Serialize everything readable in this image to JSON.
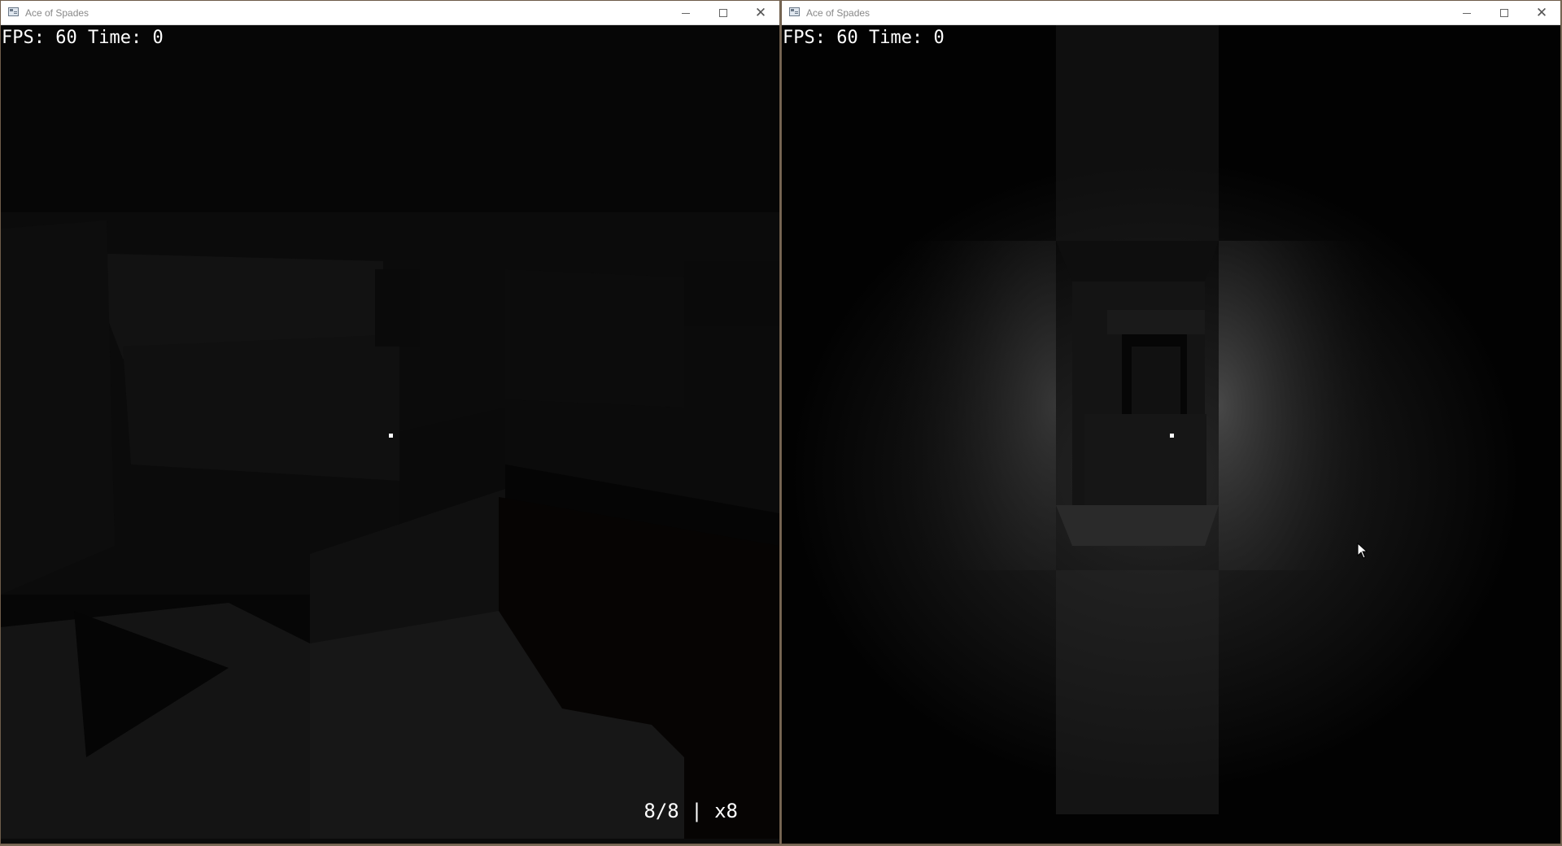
{
  "windows": [
    {
      "title": "Ace of Spades",
      "hud": {
        "fps_label": "FPS:",
        "fps_value": "60",
        "time_label": "Time:",
        "time_value": "0",
        "ammo": "8/8 | x8"
      }
    },
    {
      "title": "Ace of Spades",
      "hud": {
        "fps_label": "FPS:",
        "fps_value": "60",
        "time_label": "Time:",
        "time_value": "0"
      }
    }
  ],
  "icons": {
    "app": "window-app-icon",
    "minimize": "minimize-icon",
    "maximize": "maximize-icon",
    "close": "close-icon",
    "cursor": "mouse-pointer-icon"
  }
}
